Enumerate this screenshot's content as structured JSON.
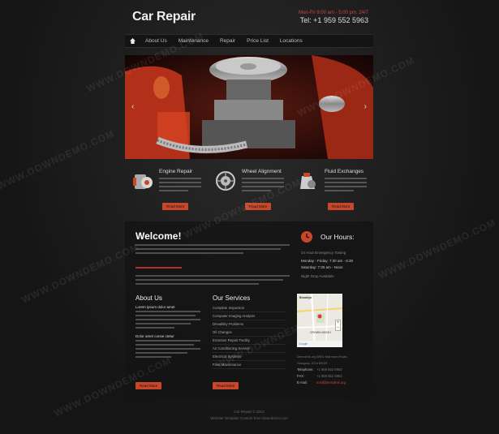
{
  "header": {
    "logo": "Car Repair",
    "contact_small": "Mon-Fri 9:00 am - 5:00 pm. 24/7",
    "phone": "Tel: +1 959 552 5963"
  },
  "nav": {
    "items": [
      "About Us",
      "Maintenance",
      "Repair",
      "Price List",
      "Locations"
    ]
  },
  "slider": {
    "prev": "‹",
    "next": "›"
  },
  "features": [
    {
      "title": "Engine Repair",
      "button": "Read More"
    },
    {
      "title": "Wheel Alignment",
      "button": "Read More"
    },
    {
      "title": "Fluid Exchanges",
      "button": "Read More"
    }
  ],
  "welcome": {
    "title": "Welcome!"
  },
  "hours": {
    "title": "Our Hours:",
    "line1": "24 Hour Emergency Towing",
    "line2": "Monday - Friday: 7:30 am - 6:30",
    "line3": "Saturday: 7:30 am - Noon",
    "line4": "Night Drop Available"
  },
  "about": {
    "title": "About Us",
    "item1": "Lorem ipsum dolor amet",
    "item2": "Dolor amet conse ctetur",
    "button": "Read More"
  },
  "services": {
    "title": "Our Services",
    "items": [
      "Complete Inspection",
      "Computer Imaging Analysis",
      "Drivability Problems",
      "Oil Changes",
      "Emission Repair Facility",
      "Air Conditioning Service",
      "Electrical Systems",
      "Fleet Maintenance"
    ],
    "button": "Read More"
  },
  "map": {
    "label1": "Brooklyn",
    "label2": "CROWN HEIGH",
    "footer": "Google"
  },
  "address": {
    "line1": "Demolink.org 8901 Marmora Road,",
    "line2": "Glasgow, DO4 89GR",
    "telephone_label": "Telephone:",
    "telephone": "+1 959 552 5963",
    "fax_label": "FAX:",
    "fax": "+1 959 552 5963",
    "email_label": "E-mail:",
    "email": "mail@demolink.org"
  },
  "footer": {
    "line1": "Car Repair © 2013",
    "line2": "Website Template Custom from downdemo.com"
  },
  "watermark": "WWW.DOWNDEMO.COM",
  "colors": {
    "accent": "#c8472a",
    "background": "#1a1a1a"
  }
}
